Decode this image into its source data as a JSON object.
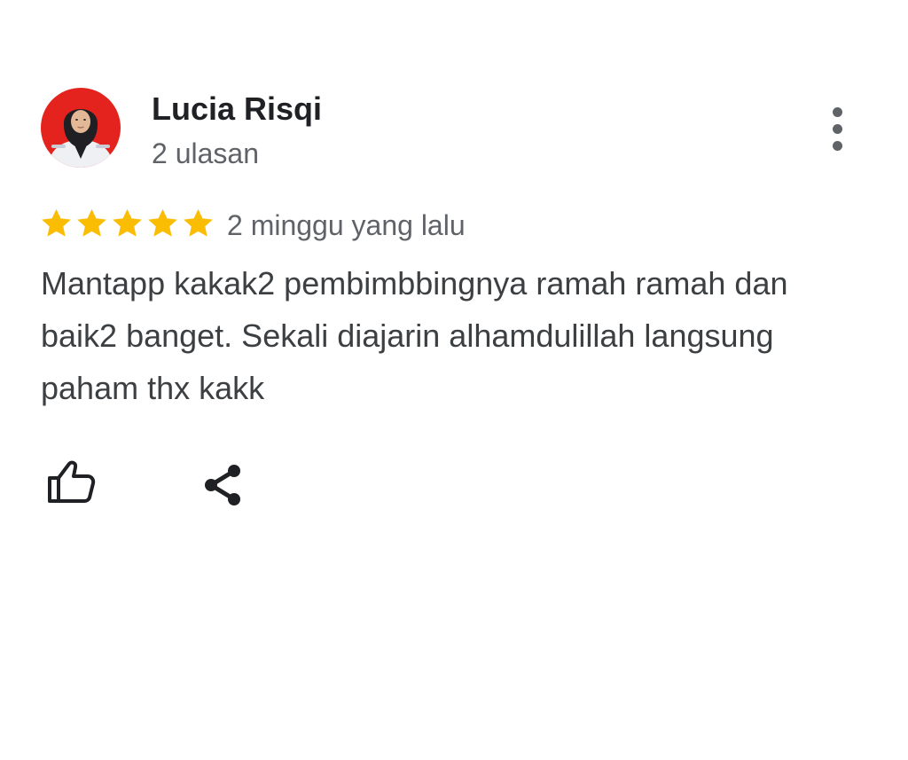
{
  "review": {
    "author": {
      "name": "Lucia Risqi",
      "review_count": "2 ulasan",
      "avatar_icon": "profile-photo"
    },
    "rating": {
      "stars": 5,
      "max_stars": 5,
      "star_color": "#fbbc04"
    },
    "timestamp": "2 minggu yang lalu",
    "text_lines": [
      "Mantapp kakak2 pembimbbingnya ramah ramah dan",
      "baik2 banget. Sekali diajarin alhamdulillah langsung",
      "paham thx kakk"
    ],
    "actions": {
      "like_icon": "thumbs-up-icon",
      "share_icon": "share-icon",
      "more_icon": "more-vert-icon"
    }
  }
}
